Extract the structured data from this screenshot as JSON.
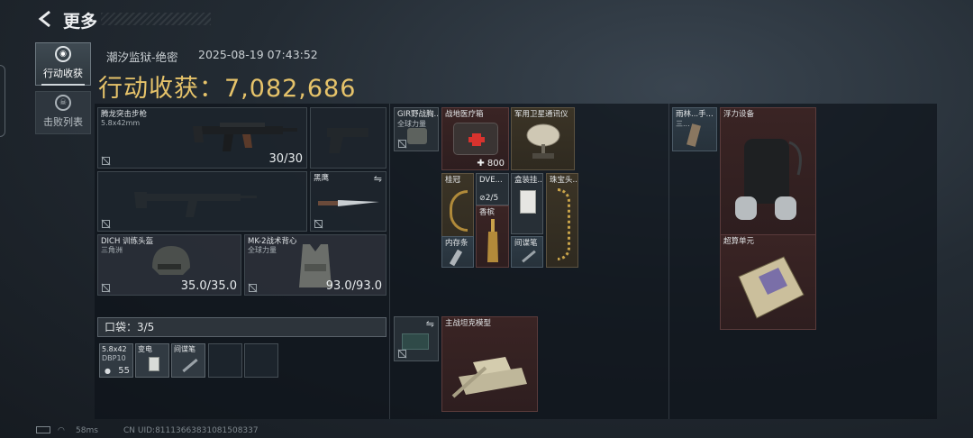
{
  "header": {
    "back_icon": "chevron-left-icon",
    "title": "更多"
  },
  "sidebar": {
    "tabs": [
      {
        "label": "行动收获",
        "icon": "loot-icon",
        "active": true
      },
      {
        "label": "击败列表",
        "icon": "skull-icon",
        "active": false
      }
    ]
  },
  "raid": {
    "map": "潮汐监狱-绝密",
    "datetime": "2025-08-19 07:43:52",
    "earnings_label": "行动收获：",
    "earnings_value": "7,082,686"
  },
  "loadout": {
    "primary": {
      "name": "腾龙突击步枪",
      "ammo": "5.8x42mm",
      "count": "30/30"
    },
    "melee": {
      "name": "黑鹰"
    },
    "helmet": {
      "name": "DICH 训练头盔",
      "sub": "三角洲",
      "durability": "35.0/35.0"
    },
    "armor": {
      "name": "MK-2战术背心",
      "sub": "全球力量",
      "durability": "93.0/93.0"
    },
    "pocket": {
      "label": "口袋：3/5",
      "items": [
        {
          "name": "5.8x42",
          "sub": "DBP10",
          "count": "55"
        },
        {
          "name": "变电"
        },
        {
          "name": "间谍笔"
        }
      ]
    }
  },
  "backpack": {
    "items": [
      {
        "name": "GIR野战胸...",
        "sub": "全球力量"
      },
      {
        "name": "战地医疗箱",
        "count": "800"
      },
      {
        "name": "军用卫星通讯仪"
      },
      {
        "name": "桂冠"
      },
      {
        "name": "DVE..."
      },
      {
        "name": "盒装挂..."
      },
      {
        "name": "珠宝头..."
      },
      {
        "name": "香槟"
      },
      {
        "name": "内存条"
      },
      {
        "name": "间谍笔"
      },
      {
        "progress": "2/5"
      },
      {
        "name": "主战坦克模型"
      }
    ]
  },
  "safebox": {
    "items": [
      {
        "name": "雨林...手...",
        "sub": "三..."
      },
      {
        "name": "浮力设备"
      },
      {
        "name": "超算单元"
      }
    ]
  },
  "footer": {
    "ping": "58ms",
    "uid": "CN UID:81113663831081508337"
  }
}
